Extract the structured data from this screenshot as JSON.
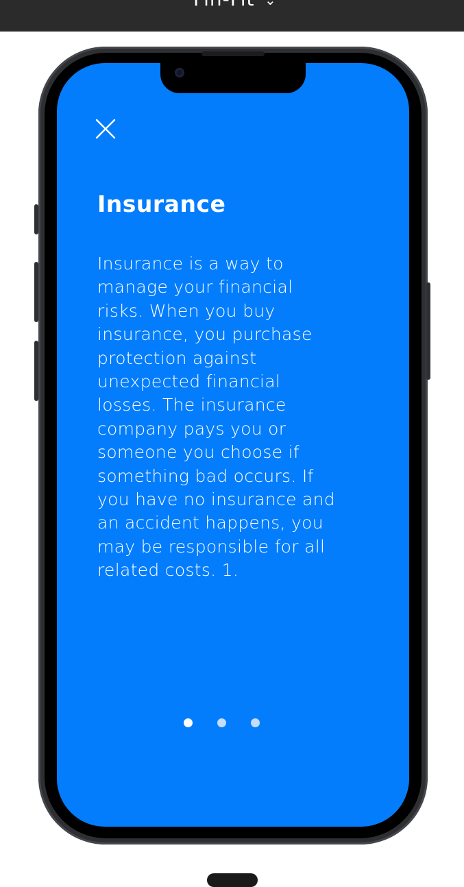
{
  "top_bar": {
    "title": "Fin-Fit",
    "chevron": "⌄"
  },
  "screen": {
    "background_color": "#047dfc",
    "close_icon": "close-icon",
    "title": "Insurance",
    "body": "Insurance is a way to\nmanage your financial\nrisks.  When you buy\ninsurance, you purchase\nprotection against\nunexpected  financial\nlosses. The insurance\ncompany pays you or\nsomeone you choose  if\nsomething bad occurs. If\nyou have no insurance and\nan accident  happens, you\nmay be responsible for all\nrelated costs. 1.",
    "pagination": {
      "total": 3,
      "active_index": 0,
      "active_color": "#ffffff",
      "inactive_color": "#c5dcfb"
    }
  }
}
